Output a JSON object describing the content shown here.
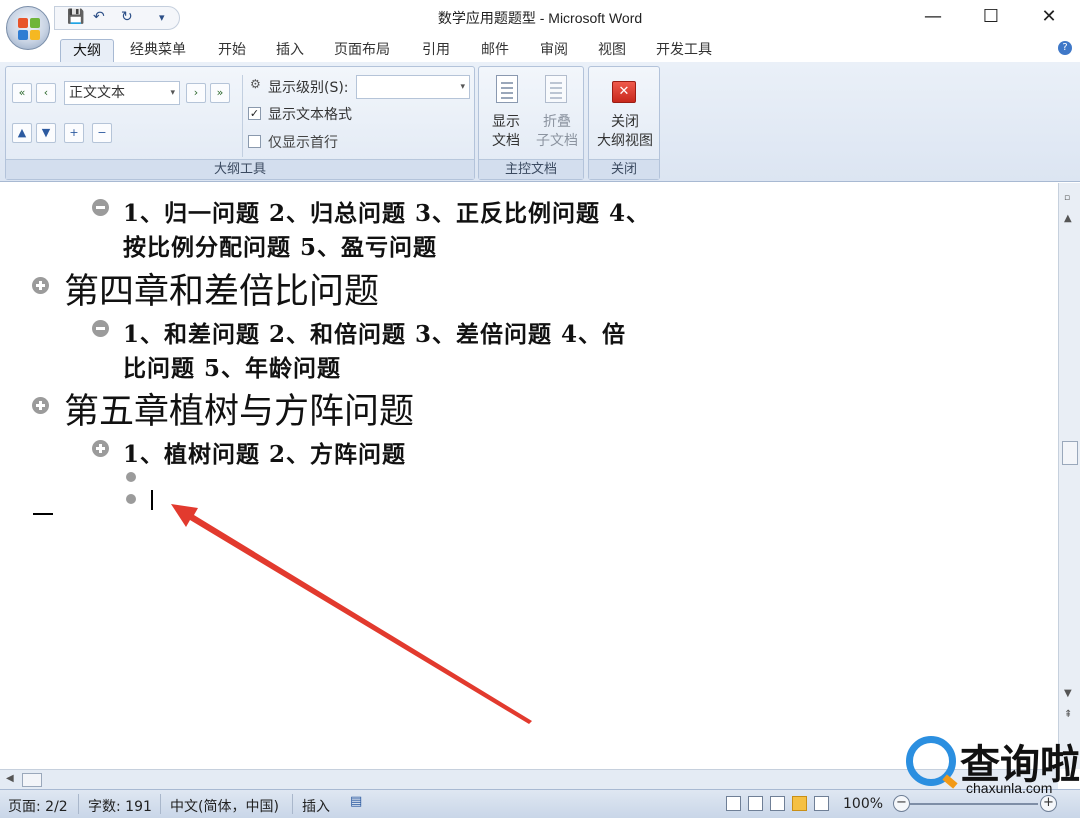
{
  "window": {
    "title": "数学应用题题型 - Microsoft Word",
    "controls": {
      "minimize": "—",
      "maximize": "☐",
      "close": "✕"
    }
  },
  "qat": {
    "save": "💾",
    "undo": "↶",
    "redo": "↻",
    "more": "▾"
  },
  "tabs": [
    {
      "label": "大纲",
      "active": true
    },
    {
      "label": "经典菜单"
    },
    {
      "label": "开始"
    },
    {
      "label": "插入"
    },
    {
      "label": "页面布局"
    },
    {
      "label": "引用"
    },
    {
      "label": "邮件"
    },
    {
      "label": "审阅"
    },
    {
      "label": "视图"
    },
    {
      "label": "开发工具"
    }
  ],
  "ribbon": {
    "outline_tools": {
      "group_label": "大纲工具",
      "level_combo": "正文文本",
      "show_level_label": "显示级别(S):",
      "show_text_format": {
        "label": "显示文本格式",
        "checked": true
      },
      "show_first_line": {
        "label": "仅显示首行",
        "checked": false
      },
      "buttons": {
        "promote_to_heading": "«",
        "promote": "‹",
        "demote": "›",
        "demote_to_body": "»",
        "move_up": "▲",
        "move_down": "▼",
        "expand": "+",
        "collapse": "−"
      }
    },
    "master_document": {
      "group_label": "主控文档",
      "show_document": [
        "显示",
        "文档"
      ],
      "collapse_subdocs": [
        "折叠",
        "子文档"
      ]
    },
    "close": {
      "group_label": "关闭",
      "close_outline": [
        "关闭",
        "大纲视图"
      ]
    }
  },
  "document": {
    "l1a": "1、归一问题  2、归总问题  3、正反比例问题  4、",
    "l1b": "按比例分配问题 5、盈亏问题",
    "h4": "第四章和差倍比问题",
    "l2a": "1、和差问题 2、和倍问题 3、差倍问题 4、倍",
    "l2b": "比问题 5、年龄问题",
    "h5": "第五章植树与方阵问题",
    "l3": "1、植树问题 2、方阵问题"
  },
  "status": {
    "page": "页面: 2/2",
    "words": "字数: 191",
    "language": "中文(简体，中国)",
    "mode": "插入",
    "zoom": "100%"
  },
  "watermark": {
    "text": "查询啦",
    "url": "chaxunla.com"
  },
  "colors": {
    "arrow": "#e23a2e",
    "ribbon_bg": "#dce5f2",
    "accent": "#2b8fe0"
  }
}
